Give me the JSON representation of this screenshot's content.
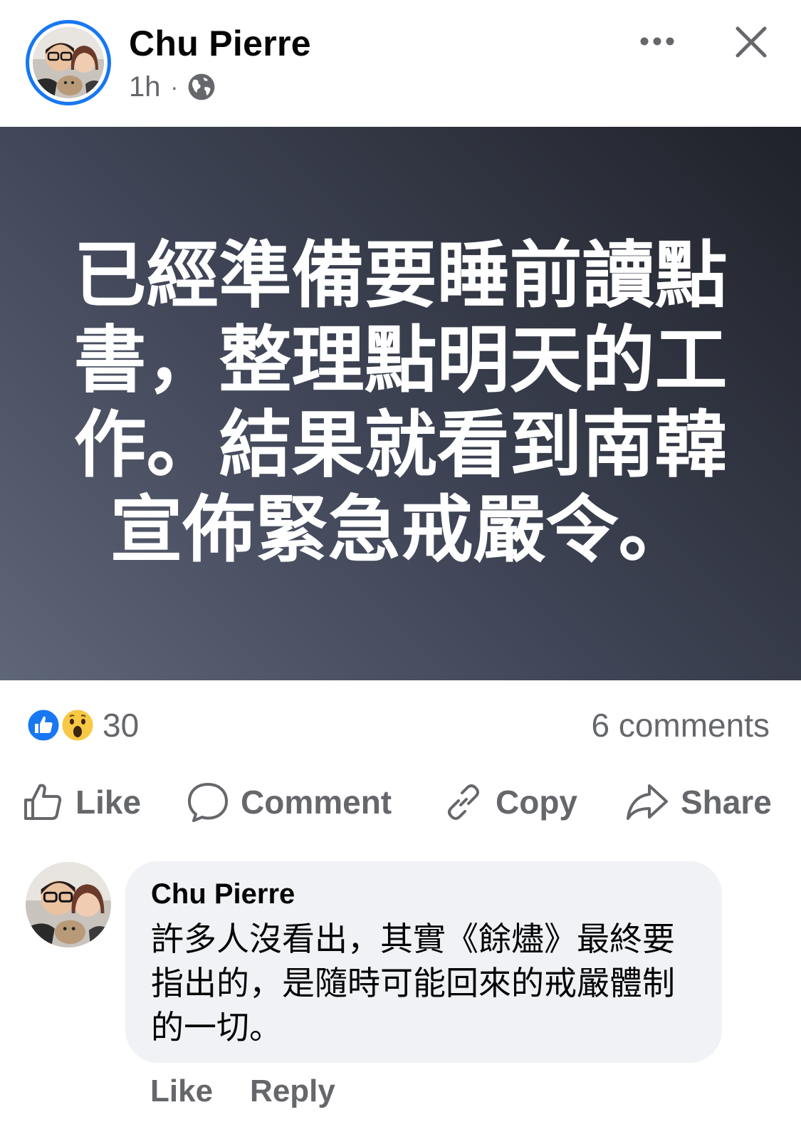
{
  "post": {
    "author": "Chu Pierre",
    "time": "1h",
    "separator": "·",
    "privacy_icon": "globe-icon",
    "text": "已經準備要睡前讀點書，整理點明天的工作。結果就看到南韓宣佈緊急戒嚴令。",
    "card_colors": {
      "from": "#5f6678",
      "to": "#202229",
      "text": "#ffffff"
    }
  },
  "reactions": {
    "icons": [
      "like-reaction-icon",
      "wow-reaction-icon"
    ],
    "count": "30",
    "comments": "6 comments"
  },
  "actions": {
    "like": "Like",
    "comment": "Comment",
    "copy": "Copy",
    "share": "Share"
  },
  "comment": {
    "author": "Chu Pierre",
    "text": "許多人沒看出，其實《餘燼》最終要指出的，是隨時可能回來的戒嚴體制的一切。",
    "like": "Like",
    "reply": "Reply"
  },
  "colors": {
    "accent": "#1877f2",
    "secondary_text": "#65676b",
    "bubble": "#f0f2f5"
  }
}
